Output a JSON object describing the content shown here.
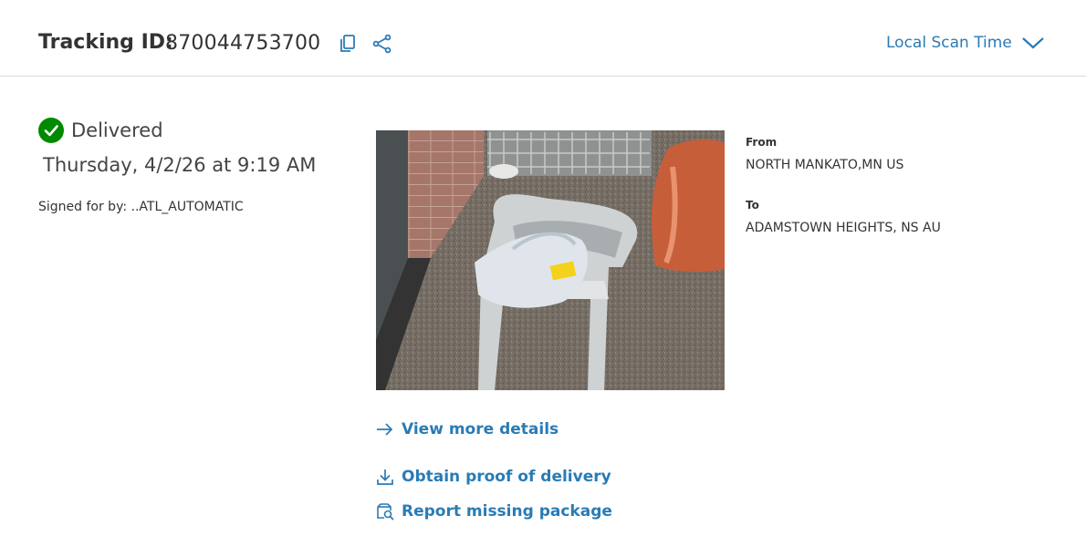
{
  "header": {
    "tracking_label": "Tracking ID:",
    "tracking_id": "870044753700",
    "scan_time_label": "Local Scan Time"
  },
  "status": {
    "label": "Delivered",
    "date": "Thursday, 4/2/26 at 9:19 AM",
    "signed_for": "Signed for by: ..ATL_AUTOMATIC"
  },
  "shipment": {
    "from_label": "From",
    "from_value": "NORTH MANKATO,MN US",
    "to_label": "To",
    "to_value": "ADAMSTOWN HEIGHTS, NS AU"
  },
  "actions": {
    "view_details": "View more details",
    "proof_of_delivery": "Obtain proof of delivery",
    "report_missing": "Report missing package"
  },
  "colors": {
    "accent": "#2a7bb5",
    "success": "#008a00"
  }
}
